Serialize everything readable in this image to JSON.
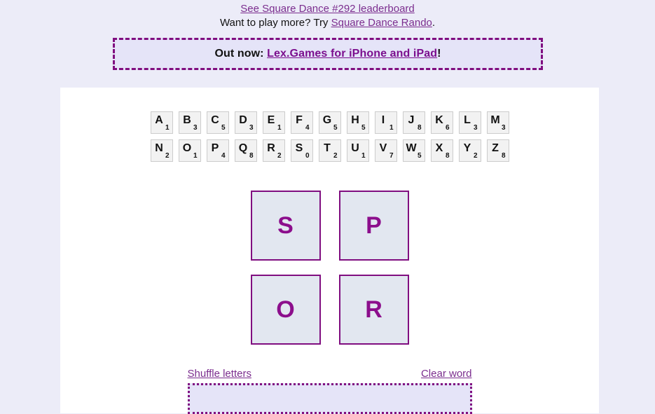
{
  "header": {
    "leaderboard_link": "See Square Dance #292 leaderboard",
    "play_more_prefix": "Want to play more? Try ",
    "rando_link": "Square Dance Rando",
    "play_more_suffix": ".",
    "promo_prefix": "Out now: ",
    "promo_link": "Lex.Games for iPhone and iPad",
    "promo_suffix": "!"
  },
  "letter_values": {
    "row1": [
      {
        "letter": "A",
        "value": "1"
      },
      {
        "letter": "B",
        "value": "3"
      },
      {
        "letter": "C",
        "value": "5"
      },
      {
        "letter": "D",
        "value": "3"
      },
      {
        "letter": "E",
        "value": "1"
      },
      {
        "letter": "F",
        "value": "4"
      },
      {
        "letter": "G",
        "value": "5"
      },
      {
        "letter": "H",
        "value": "5"
      },
      {
        "letter": "I",
        "value": "1"
      },
      {
        "letter": "J",
        "value": "8"
      },
      {
        "letter": "K",
        "value": "6"
      },
      {
        "letter": "L",
        "value": "3"
      },
      {
        "letter": "M",
        "value": "3"
      }
    ],
    "row2": [
      {
        "letter": "N",
        "value": "2"
      },
      {
        "letter": "O",
        "value": "1"
      },
      {
        "letter": "P",
        "value": "4"
      },
      {
        "letter": "Q",
        "value": "8"
      },
      {
        "letter": "R",
        "value": "2"
      },
      {
        "letter": "S",
        "value": "0"
      },
      {
        "letter": "T",
        "value": "2"
      },
      {
        "letter": "U",
        "value": "1"
      },
      {
        "letter": "V",
        "value": "7"
      },
      {
        "letter": "W",
        "value": "5"
      },
      {
        "letter": "X",
        "value": "8"
      },
      {
        "letter": "Y",
        "value": "2"
      },
      {
        "letter": "Z",
        "value": "8"
      }
    ]
  },
  "board": {
    "tiles": [
      "S",
      "P",
      "O",
      "R"
    ]
  },
  "controls": {
    "shuffle_label": "Shuffle letters",
    "clear_label": "Clear word",
    "word_input_value": "",
    "word_input_placeholder": ""
  },
  "colors": {
    "page_background": "#ececf8",
    "card_background": "#ffffff",
    "link_purple": "#7b2d8e",
    "accent_purple": "#800e80",
    "board_tile_fill": "#e2e7f0",
    "board_letter": "#8c0e8c",
    "value_tile_fill": "#f2f2f2",
    "panel_fill": "#e5e4f8"
  }
}
